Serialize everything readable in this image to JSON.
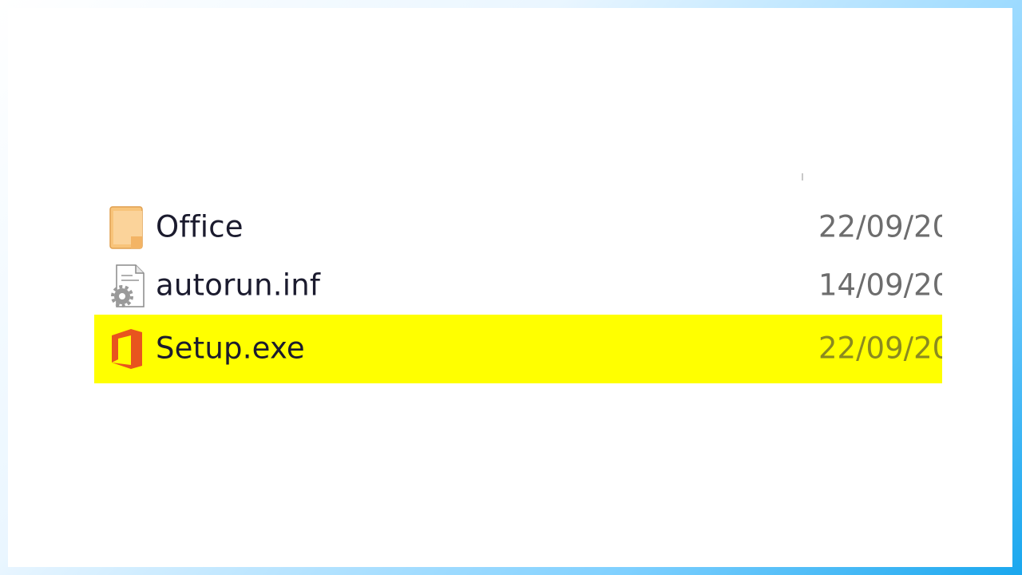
{
  "files": [
    {
      "name": "Office",
      "date": "22/09/20",
      "icon": "folder-icon"
    },
    {
      "name": "autorun.inf",
      "date": "14/09/20",
      "icon": "settings-file-icon"
    },
    {
      "name": "Setup.exe",
      "date": "22/09/20",
      "icon": "office-logo-icon",
      "highlighted": true
    }
  ],
  "colors": {
    "highlight": "#ffff00",
    "folder": "#f8c47a",
    "office_logo": "#e8541e",
    "frame_gradient": "#1aa7ee"
  }
}
